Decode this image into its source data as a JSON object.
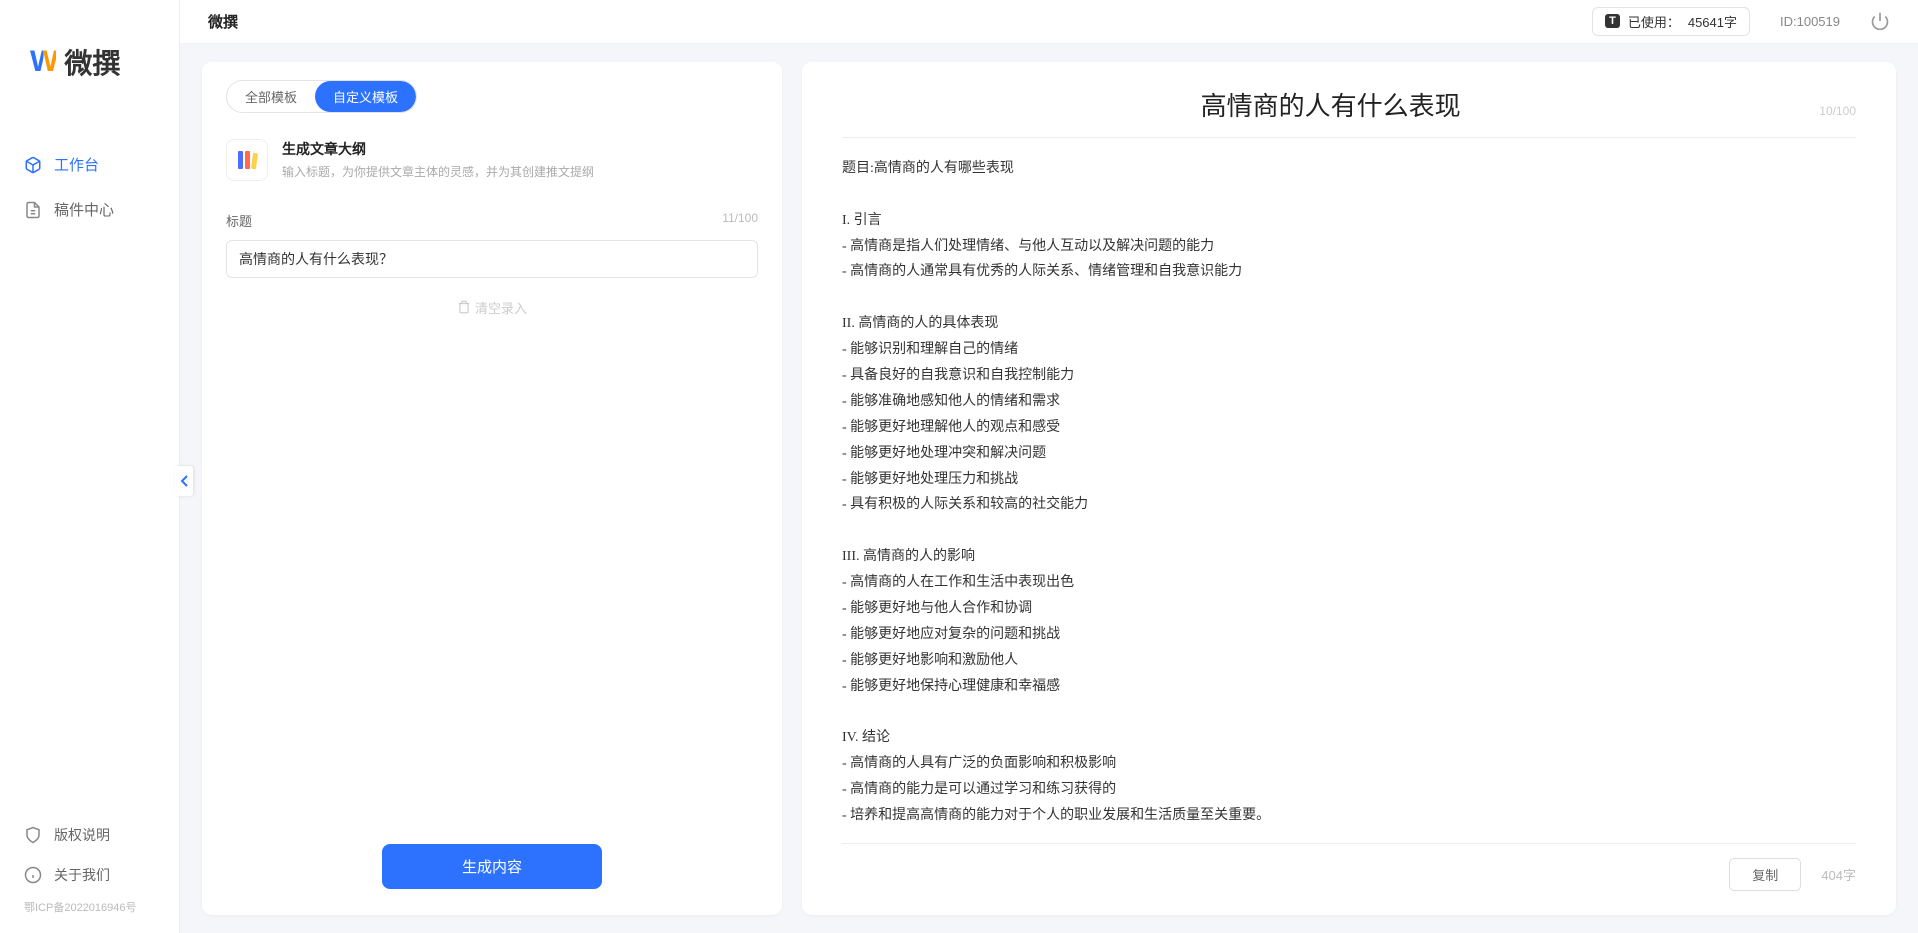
{
  "app": {
    "name": "微撰"
  },
  "sidebar": {
    "logo_text": "微撰",
    "items": [
      {
        "label": "工作台",
        "active": true
      },
      {
        "label": "稿件中心",
        "active": false
      }
    ],
    "bottom": [
      {
        "label": "版权说明"
      },
      {
        "label": "关于我们"
      }
    ],
    "icp": "鄂ICP备2022016946号"
  },
  "topbar": {
    "title": "微撰",
    "usage_label": "已使用：",
    "usage_value": "45641字",
    "id_label": "ID:100519"
  },
  "left": {
    "tabs": [
      {
        "label": "全部模板",
        "active": false
      },
      {
        "label": "自定义模板",
        "active": true
      }
    ],
    "template": {
      "title": "生成文章大纲",
      "subtitle": "输入标题，为你提供文章主体的灵感，并为其创建推文提纲"
    },
    "field": {
      "label": "标题",
      "count": "11/100",
      "value": "高情商的人有什么表现？"
    },
    "clear": "清空录入",
    "generate": "生成内容"
  },
  "right": {
    "title": "高情商的人有什么表现",
    "title_count": "10/100",
    "body": "题目:高情商的人有哪些表现\n\nI. 引言\n- 高情商是指人们处理情绪、与他人互动以及解决问题的能力\n- 高情商的人通常具有优秀的人际关系、情绪管理和自我意识能力\n\nII. 高情商的人的具体表现\n- 能够识别和理解自己的情绪\n- 具备良好的自我意识和自我控制能力\n- 能够准确地感知他人的情绪和需求\n- 能够更好地理解他人的观点和感受\n- 能够更好地处理冲突和解决问题\n- 能够更好地处理压力和挑战\n- 具有积极的人际关系和较高的社交能力\n\nIII. 高情商的人的影响\n- 高情商的人在工作和生活中表现出色\n- 能够更好地与他人合作和协调\n- 能够更好地应对复杂的问题和挑战\n- 能够更好地影响和激励他人\n- 能够更好地保持心理健康和幸福感\n\nIV. 结论\n- 高情商的人具有广泛的负面影响和积极影响\n- 高情商的能力是可以通过学习和练习获得的\n- 培养和提高高情商的能力对于个人的职业发展和生活质量至关重要。",
    "copy": "复制",
    "char_count": "404字"
  }
}
